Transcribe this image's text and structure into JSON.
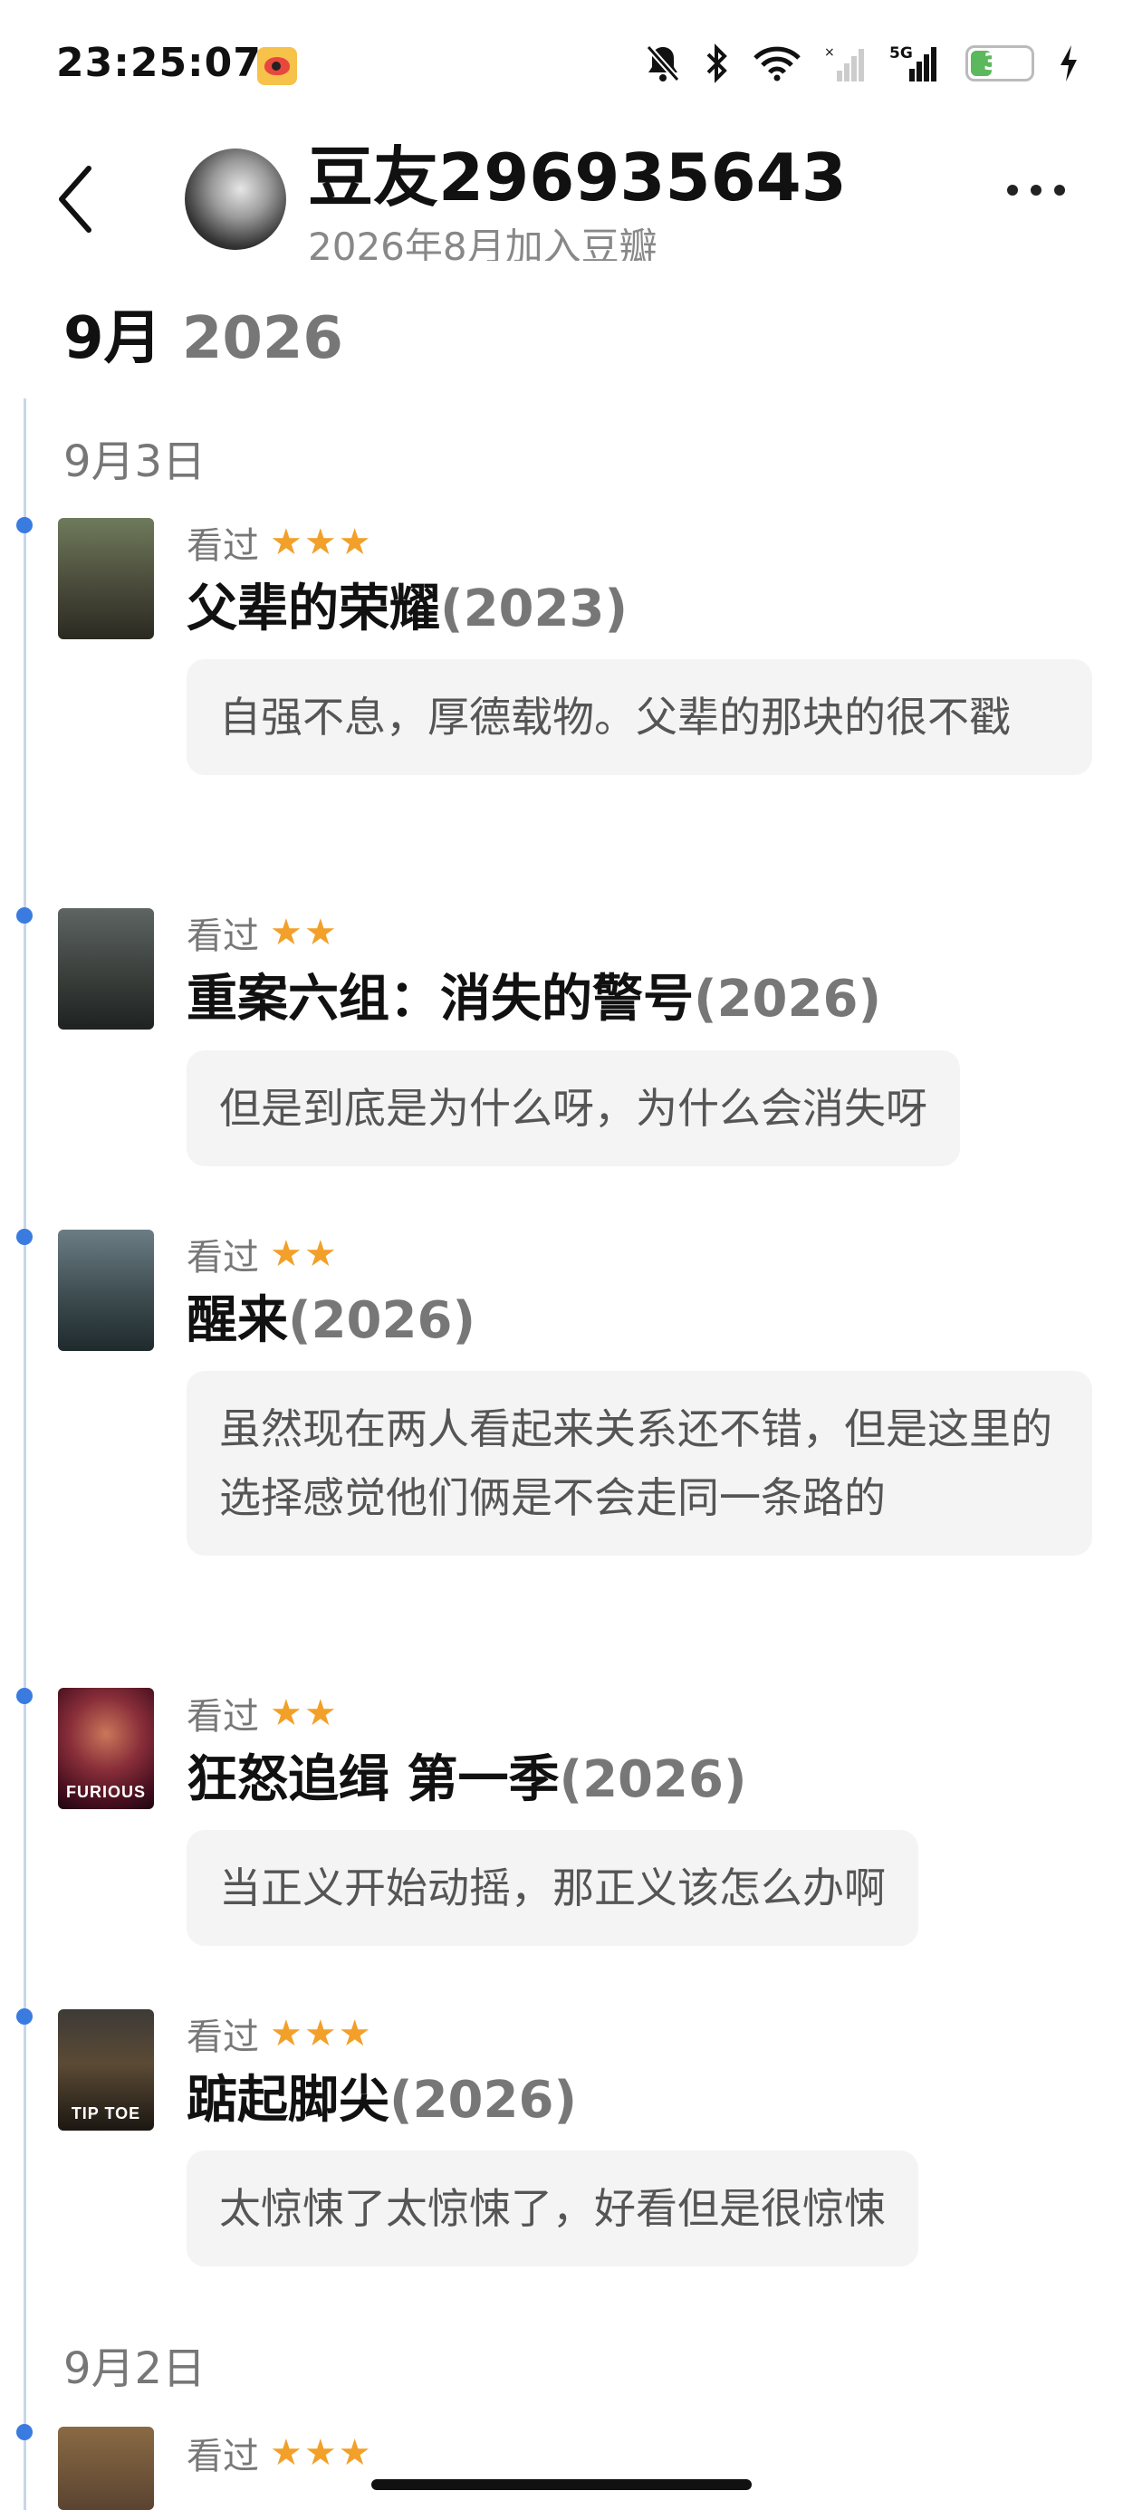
{
  "status_bar": {
    "time": "23:25:07",
    "battery": "33",
    "icons": [
      "weibo-icon",
      "mute-bell-icon",
      "bluetooth-icon",
      "wifi-icon",
      "signal-icon",
      "5g-signal-icon",
      "battery-icon",
      "charging-icon"
    ]
  },
  "header": {
    "username": "豆友296935643",
    "join_date": "2026年8月加入豆瓣"
  },
  "month": {
    "month": "9月",
    "year": "2026"
  },
  "days": [
    {
      "label": "9月3日"
    },
    {
      "label": "9月2日"
    }
  ],
  "entries": [
    {
      "status": "看过",
      "stars": "★★★",
      "rating": 3,
      "title": "父辈的荣耀",
      "year": "(2023)",
      "comment": "自强不息，厚德载物。父辈的那块的很不戳"
    },
    {
      "status": "看过",
      "stars": "★★",
      "rating": 2,
      "title": "重案六组：消失的警号",
      "year": "(2026)",
      "comment": "但是到底是为什么呀，为什么会消失呀"
    },
    {
      "status": "看过",
      "stars": "★★",
      "rating": 2,
      "title": "醒来",
      "year": "(2026)",
      "comment": "虽然现在两人看起来关系还不错，但是这里的选择感觉他们俩是不会走同一条路的"
    },
    {
      "status": "看过",
      "stars": "★★",
      "rating": 2,
      "title": "狂怒追缉 第一季",
      "year": "(2026)",
      "comment": "当正义开始动摇，那正义该怎么办啊"
    },
    {
      "status": "看过",
      "stars": "★★★",
      "rating": 3,
      "title": "踮起脚尖",
      "year": "(2026)",
      "comment": "太惊悚了太惊悚了，好看但是很惊悚"
    },
    {
      "status": "看过",
      "stars": "★★★",
      "rating": 3
    }
  ],
  "posters": [
    "",
    "",
    "",
    "FURIOUS",
    "TIP TOE",
    ""
  ],
  "colors": {
    "star": "#f2a029",
    "timeline_dot": "#3a7be0",
    "comment_bg": "#f4f4f4"
  }
}
